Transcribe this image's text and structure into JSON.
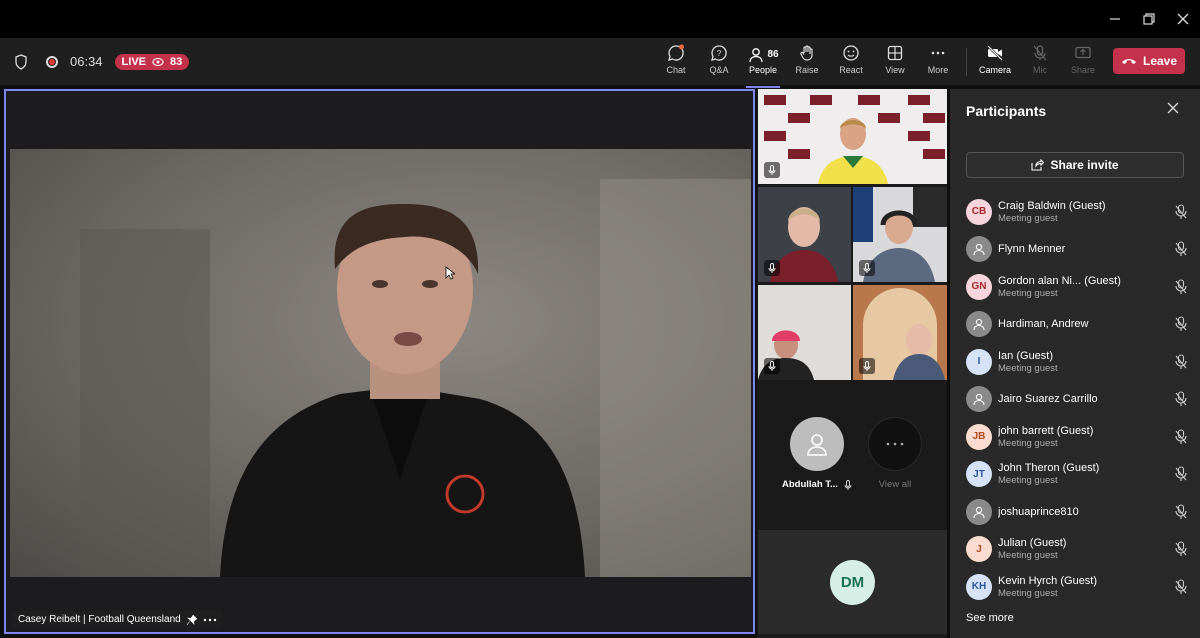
{
  "header": {
    "timer": "06:34",
    "live_label": "LIVE",
    "viewer_count": "83"
  },
  "toolbar": {
    "chat": "Chat",
    "qa": "Q&A",
    "people": "People",
    "people_count": "86",
    "raise": "Raise",
    "react": "React",
    "view": "View",
    "more": "More",
    "camera": "Camera",
    "mic": "Mic",
    "share": "Share",
    "leave": "Leave"
  },
  "stage": {
    "speaker_name": "Casey Reibelt | Football Queensland"
  },
  "grid": {
    "abdullah_name": "Abdullah T...",
    "view_all": "View all",
    "dm_initials": "DM"
  },
  "panel": {
    "title": "Participants",
    "share_invite": "Share invite",
    "see_more": "See more",
    "participants": [
      {
        "initials": "CB",
        "name": "Craig Baldwin (Guest)",
        "sub": "Meeting guest",
        "bg": "#f7d5dc",
        "fg": "#a4262c"
      },
      {
        "initials": "",
        "name": "Flynn Menner",
        "sub": "",
        "bg": "#8a8a8a",
        "fg": "#fff"
      },
      {
        "initials": "GN",
        "name": "Gordon alan Ni... (Guest)",
        "sub": "Meeting guest",
        "bg": "#f7d5dc",
        "fg": "#a4262c"
      },
      {
        "initials": "",
        "name": "Hardiman, Andrew",
        "sub": "",
        "bg": "#8a8a8a",
        "fg": "#fff"
      },
      {
        "initials": "I",
        "name": "Ian (Guest)",
        "sub": "Meeting guest",
        "bg": "#d6e3f7",
        "fg": "#2b5797"
      },
      {
        "initials": "",
        "name": "Jairo Suarez Carrillo",
        "sub": "",
        "bg": "#8a8a8a",
        "fg": "#fff"
      },
      {
        "initials": "JB",
        "name": "john barrett (Guest)",
        "sub": "Meeting guest",
        "bg": "#f9dccf",
        "fg": "#b24a1c"
      },
      {
        "initials": "JT",
        "name": "John Theron (Guest)",
        "sub": "Meeting guest",
        "bg": "#d6e3f7",
        "fg": "#2b5797"
      },
      {
        "initials": "",
        "name": "joshuaprince810",
        "sub": "",
        "bg": "#8a8a8a",
        "fg": "#fff"
      },
      {
        "initials": "J",
        "name": "Julian (Guest)",
        "sub": "Meeting guest",
        "bg": "#f9dccf",
        "fg": "#b24a1c"
      },
      {
        "initials": "KH",
        "name": "Kevin Hyrch (Guest)",
        "sub": "Meeting guest",
        "bg": "#d6e3f7",
        "fg": "#2b5797"
      }
    ]
  }
}
